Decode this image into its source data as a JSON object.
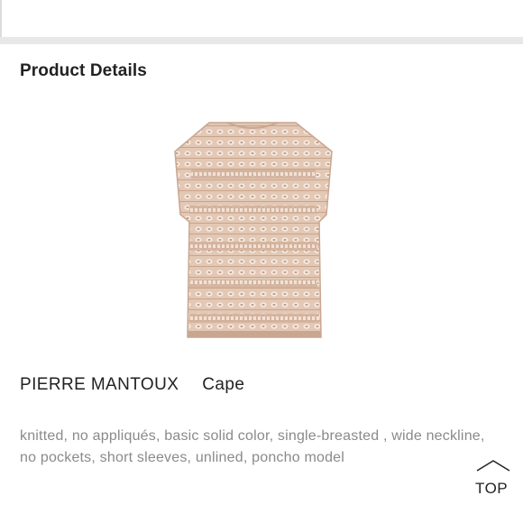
{
  "section": {
    "title": "Product Details"
  },
  "product": {
    "brand": "PIERRE MANTOUX",
    "type": "Cape",
    "description": "knitted, no appliqués, basic solid color, single-breasted , wide neckline, no pockets, short sleeves, unlined, poncho model",
    "image_icon": "cape-product-image",
    "color": "#d8b9a4"
  },
  "nav": {
    "top_label": "TOP",
    "top_icon": "chevron-up-icon"
  },
  "colors": {
    "divider": "#e8e8e8",
    "text_primary": "#222222",
    "text_secondary": "#8a8a8a"
  }
}
